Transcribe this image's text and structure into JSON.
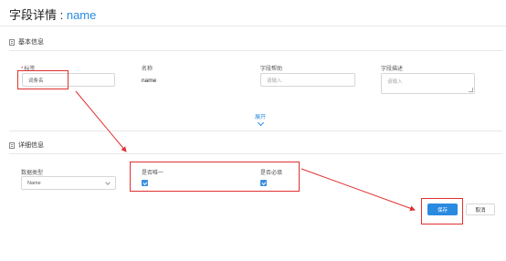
{
  "page": {
    "title_prefix": "字段详情 : ",
    "title_name": "name"
  },
  "basic_section": {
    "heading": "基本信息",
    "fields": {
      "label": {
        "required_mark": "*",
        "caption": "标签",
        "value": "词条名"
      },
      "name": {
        "caption": "名称",
        "value": "name"
      },
      "help": {
        "caption": "字段帮助",
        "placeholder": "请输入"
      },
      "description": {
        "caption": "字段描述",
        "placeholder": "请输入"
      }
    },
    "expand_label": "展开"
  },
  "detail_section": {
    "heading": "详细信息",
    "data_type": {
      "caption": "数据类型",
      "value": "Name"
    },
    "unique": {
      "caption": "是否唯一",
      "checked": true
    },
    "required": {
      "caption": "是否必填",
      "checked": true
    }
  },
  "actions": {
    "save_label": "保存",
    "cancel_label": "取消"
  },
  "colors": {
    "accent": "#2a8ae0",
    "annotation": "#e03030"
  }
}
